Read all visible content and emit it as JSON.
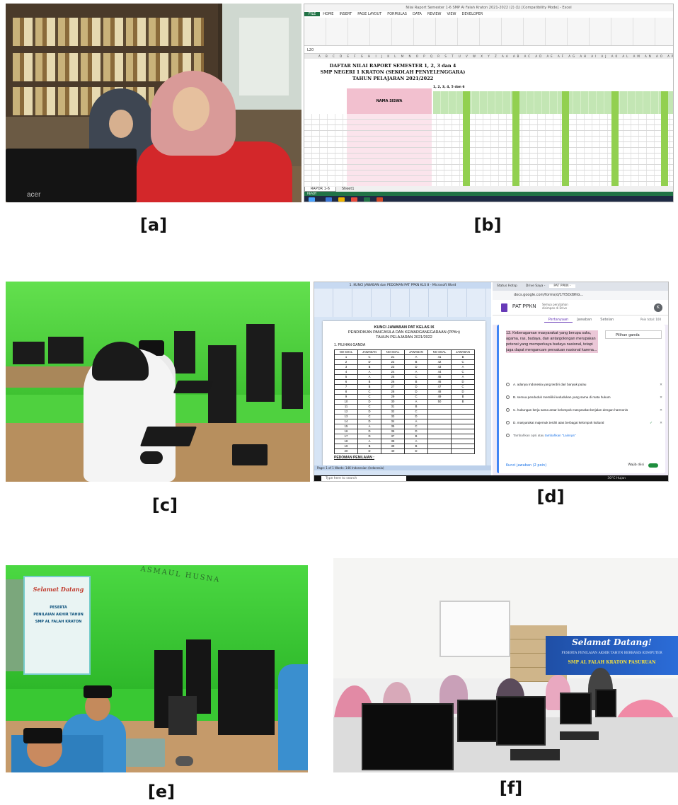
{
  "captions": {
    "a": "[a]",
    "b": "[b]",
    "c": "[c]",
    "d": "[d]",
    "e": "[e]",
    "f": "[f]"
  },
  "panel_a": {
    "laptop_logo": "acer"
  },
  "panel_b": {
    "window_title": "Nilai Raport Semester 1-6 SMP Al Falah Kraton 2021-2022 (2) (1) [Compatibility Mode] - Excel",
    "ribbon_tabs": [
      "FILE",
      "HOME",
      "INSERT",
      "PAGE LAYOUT",
      "FORMULAS",
      "DATA",
      "REVIEW",
      "VIEW",
      "DEVELOPER"
    ],
    "cell_ref": "L20",
    "sheet_title_1": "DAFTAR NILAI RAPORT SEMESTER 1, 2, 3 dan 4",
    "sheet_title_2": "SMP NEGERI 1 KRATON (SEKOLAH PENYELENGGARA)",
    "sheet_title_3": "TAHUN PELAJARAN 2021/2022",
    "semester_label": "1, 2, 3, 4, 5 dan 6",
    "name_header": "NAMA SISWA",
    "sheet_tabs": [
      "RAPOR 1-6",
      "Sheet1"
    ],
    "status": "READY"
  },
  "panel_d": {
    "word_title": "1. KUNCI JAWABAN dan PEDOMAN PAT PPKN KLS 8 - Microsoft Word",
    "doc_title_1": "KUNCI JAWABAN PAT KELAS IX",
    "doc_title_2": "PENDIDIKAN PANCASILA DAN KEWARGANEGARAAN (PPKn)",
    "doc_title_3": "TAHUN PELAJARAN 2021/2022",
    "section_label": "1.   PILIHAN GANDA",
    "table_headers": [
      "NO SOAL",
      "JAWABAN",
      "NO SOAL",
      "JAWABAN",
      "NO SOAL",
      "JAWABAN"
    ],
    "table_rows": [
      [
        "1",
        "C",
        "21",
        "A",
        "41",
        "B"
      ],
      [
        "2",
        "D",
        "22",
        "B",
        "42",
        "C"
      ],
      [
        "3",
        "B",
        "23",
        "D",
        "43",
        "A"
      ],
      [
        "4",
        "A",
        "24",
        "A",
        "44",
        "C"
      ],
      [
        "5",
        "A",
        "25",
        "C",
        "45",
        "A"
      ],
      [
        "6",
        "B",
        "26",
        "B",
        "46",
        "D"
      ],
      [
        "7",
        "B",
        "27",
        "D",
        "47",
        "C"
      ],
      [
        "8",
        "C",
        "28",
        "D",
        "48",
        "D"
      ],
      [
        "9",
        "C",
        "29",
        "C",
        "49",
        "B"
      ],
      [
        "10",
        "D",
        "30",
        "A",
        "50",
        "B"
      ],
      [
        "11",
        "C",
        "31",
        "B",
        "",
        ""
      ],
      [
        "12",
        "D",
        "32",
        "C",
        "",
        ""
      ],
      [
        "13",
        "C",
        "33",
        "D",
        "",
        ""
      ],
      [
        "14",
        "D",
        "34",
        "A",
        "",
        ""
      ],
      [
        "15",
        "A",
        "35",
        "C",
        "",
        ""
      ],
      [
        "16",
        "D",
        "36",
        "D",
        "",
        ""
      ],
      [
        "17",
        "D",
        "37",
        "B",
        "",
        ""
      ],
      [
        "18",
        "A",
        "38",
        "A",
        "",
        ""
      ],
      [
        "19",
        "B",
        "39",
        "B",
        "",
        ""
      ],
      [
        "20",
        "D",
        "40",
        "D",
        "",
        ""
      ]
    ],
    "pedoman_label": "PEDOMAN PENILAIAN :",
    "word_status": "Page: 1 of 1   Words: 146   Indonesian (Indonesia)",
    "browser_tabs": [
      "Status Hotsp",
      "Drive Saya -",
      "PAT PPKN -"
    ],
    "address": "docs.google.com/forms/d/1Yt5Dd9hG...",
    "form_name": "PAT PPKN",
    "form_saved": "Semua perubahan disimpan di Drive",
    "avatar_letter": "K",
    "form_tabs": [
      "Pertanyaan",
      "Jawaban",
      "Setelan"
    ],
    "points_total": "Poin total: 100",
    "question": "13. Keberagaman masyarakat yang berupa suku, agama, ras, budaya, dan antargolongan merupakan potensi yang memperkaya budaya nasional, tetapi juga dapat mengancam persatuan nasional karena...",
    "question_type": "Pilihan ganda",
    "options": [
      "A. adanya Indonesia yang terdiri dari banyak pulau",
      "B. semua penduduk memiliki kedudukan yang sama di mata hukum",
      "C. hubungan kerja sama antar kelompok masyarakat berjalan dengan harmonis",
      "D. masyarakat majemuk terdiri atas berbagai kelompok kultural"
    ],
    "add_option_text": "Tambahkan opsi",
    "add_option_or": "atau",
    "add_other_link": "tambahkan \"Lainnya\"",
    "answer_key": "Kunci jawaban   (2 poin)",
    "required_label": "Wajib diisi",
    "taskbar_search": "Type here to search",
    "weather": "30°C  Hujan"
  },
  "panel_e": {
    "wall_text": "ASMAUL HUSNA",
    "banner_greeting": "Selamat Datang",
    "banner_line_1": "PESERTA",
    "banner_line_2": "PENILAIAN AKHIR TAHUN",
    "banner_line_3": "SMP AL FALAH KRATON"
  },
  "panel_f": {
    "banner_title": "Selamat Datang!",
    "banner_sub": "PESERTA PENILAIAN AKHIR TAHUN BERBASIS KOMPUTER",
    "banner_school": "SMP AL FALAH KRATON PASURUAN"
  }
}
